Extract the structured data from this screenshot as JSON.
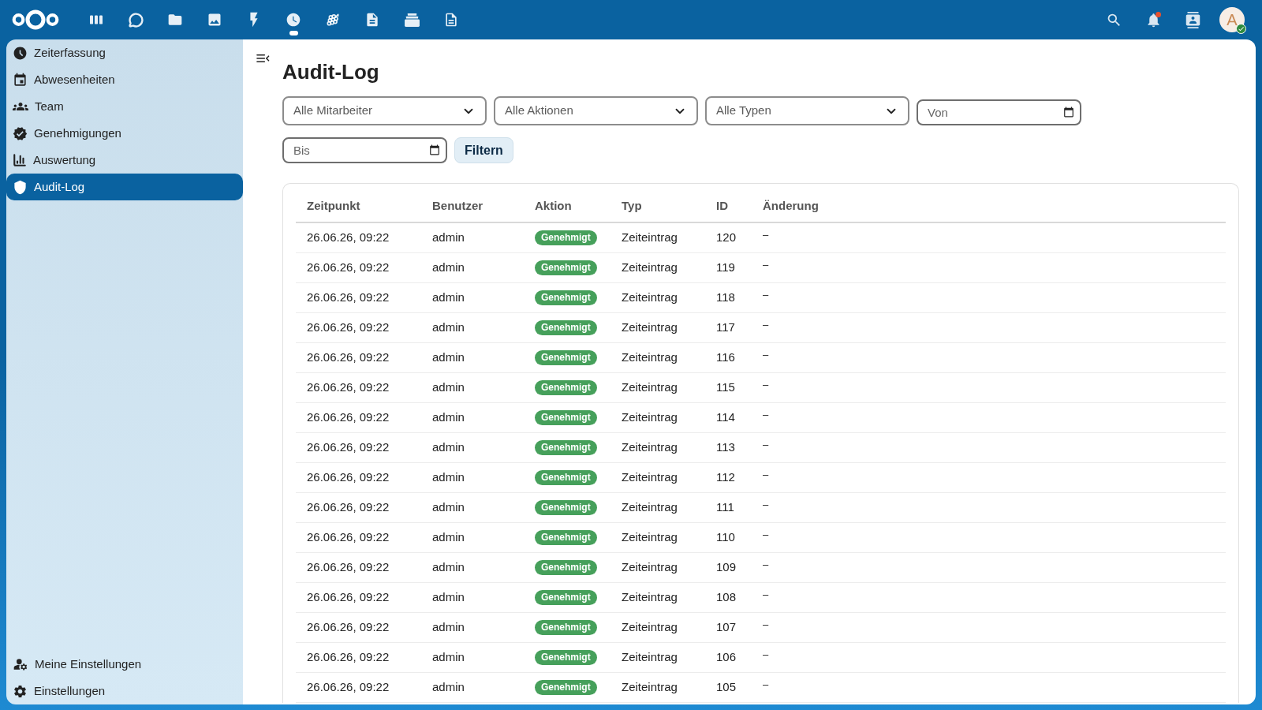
{
  "top_bar": {
    "apps": [
      {
        "selected": false
      },
      {
        "selected": false
      },
      {
        "selected": false
      },
      {
        "selected": false
      },
      {
        "selected": false
      },
      {
        "selected": true
      },
      {
        "selected": false
      },
      {
        "selected": false
      },
      {
        "selected": false
      },
      {
        "selected": false
      }
    ],
    "notifications": {
      "unread": true
    },
    "user": {
      "avatar_letter": "A",
      "online": true
    }
  },
  "sidebar": {
    "items": [
      {
        "label": "Zeiterfassung",
        "selected": false
      },
      {
        "label": "Abwesenheiten",
        "selected": false
      },
      {
        "label": "Team",
        "selected": false
      },
      {
        "label": "Genehmigungen",
        "selected": false
      },
      {
        "label": "Auswertung",
        "selected": false
      },
      {
        "label": "Audit-Log",
        "selected": true
      }
    ],
    "footer_items": [
      {
        "label": "Meine Einstellungen"
      },
      {
        "label": "Einstellungen"
      }
    ]
  },
  "page": {
    "title": "Audit-Log"
  },
  "filters": [
    {
      "kind": "select",
      "value": "Alle Mitarbeiter"
    },
    {
      "kind": "select",
      "value": "Alle Aktionen"
    },
    {
      "kind": "select",
      "value": "Alle Typen"
    },
    {
      "kind": "date",
      "placeholder": "Von"
    },
    {
      "kind": "date",
      "placeholder": "Bis"
    }
  ],
  "filter_button": "Filtern",
  "table": {
    "columns": [
      "Zeitpunkt",
      "Benutzer",
      "Aktion",
      "Typ",
      "ID",
      "Änderung"
    ],
    "rows": [
      {
        "zeitpunkt": "26.06.26, 09:22",
        "benutzer": "admin",
        "aktion": "Genehmigt",
        "typ": "Zeiteintrag",
        "id": "120",
        "aenderung": "–"
      },
      {
        "zeitpunkt": "26.06.26, 09:22",
        "benutzer": "admin",
        "aktion": "Genehmigt",
        "typ": "Zeiteintrag",
        "id": "119",
        "aenderung": "–"
      },
      {
        "zeitpunkt": "26.06.26, 09:22",
        "benutzer": "admin",
        "aktion": "Genehmigt",
        "typ": "Zeiteintrag",
        "id": "118",
        "aenderung": "–"
      },
      {
        "zeitpunkt": "26.06.26, 09:22",
        "benutzer": "admin",
        "aktion": "Genehmigt",
        "typ": "Zeiteintrag",
        "id": "117",
        "aenderung": "–"
      },
      {
        "zeitpunkt": "26.06.26, 09:22",
        "benutzer": "admin",
        "aktion": "Genehmigt",
        "typ": "Zeiteintrag",
        "id": "116",
        "aenderung": "–"
      },
      {
        "zeitpunkt": "26.06.26, 09:22",
        "benutzer": "admin",
        "aktion": "Genehmigt",
        "typ": "Zeiteintrag",
        "id": "115",
        "aenderung": "–"
      },
      {
        "zeitpunkt": "26.06.26, 09:22",
        "benutzer": "admin",
        "aktion": "Genehmigt",
        "typ": "Zeiteintrag",
        "id": "114",
        "aenderung": "–"
      },
      {
        "zeitpunkt": "26.06.26, 09:22",
        "benutzer": "admin",
        "aktion": "Genehmigt",
        "typ": "Zeiteintrag",
        "id": "113",
        "aenderung": "–"
      },
      {
        "zeitpunkt": "26.06.26, 09:22",
        "benutzer": "admin",
        "aktion": "Genehmigt",
        "typ": "Zeiteintrag",
        "id": "112",
        "aenderung": "–"
      },
      {
        "zeitpunkt": "26.06.26, 09:22",
        "benutzer": "admin",
        "aktion": "Genehmigt",
        "typ": "Zeiteintrag",
        "id": "111",
        "aenderung": "–"
      },
      {
        "zeitpunkt": "26.06.26, 09:22",
        "benutzer": "admin",
        "aktion": "Genehmigt",
        "typ": "Zeiteintrag",
        "id": "110",
        "aenderung": "–"
      },
      {
        "zeitpunkt": "26.06.26, 09:22",
        "benutzer": "admin",
        "aktion": "Genehmigt",
        "typ": "Zeiteintrag",
        "id": "109",
        "aenderung": "–"
      },
      {
        "zeitpunkt": "26.06.26, 09:22",
        "benutzer": "admin",
        "aktion": "Genehmigt",
        "typ": "Zeiteintrag",
        "id": "108",
        "aenderung": "–"
      },
      {
        "zeitpunkt": "26.06.26, 09:22",
        "benutzer": "admin",
        "aktion": "Genehmigt",
        "typ": "Zeiteintrag",
        "id": "107",
        "aenderung": "–"
      },
      {
        "zeitpunkt": "26.06.26, 09:22",
        "benutzer": "admin",
        "aktion": "Genehmigt",
        "typ": "Zeiteintrag",
        "id": "106",
        "aenderung": "–"
      },
      {
        "zeitpunkt": "26.06.26, 09:22",
        "benutzer": "admin",
        "aktion": "Genehmigt",
        "typ": "Zeiteintrag",
        "id": "105",
        "aenderung": "–"
      }
    ]
  }
}
